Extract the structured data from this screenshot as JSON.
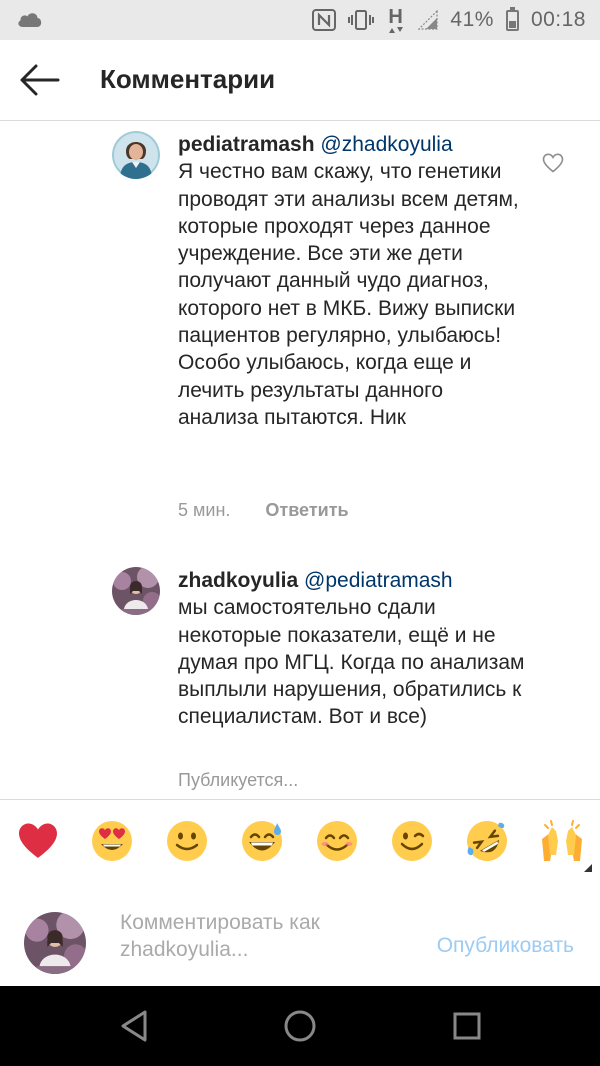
{
  "status_bar": {
    "battery_percent": "41%",
    "time": "00:18",
    "network": "H"
  },
  "header": {
    "title": "Комментарии"
  },
  "comments": [
    {
      "username": "pediatramash",
      "mention": "@zhadkoyulia",
      "text": "Я честно вам скажу, что генетики проводят эти анализы всем детям, которые проходят через данное учреждение. Все эти же дети получают данный чудо диагноз, которого нет в МКБ. Вижу выписки пациентов регулярно, улыбаюсь! Особо улыбаюсь, когда еще и лечить результаты данного анализа пытаются. Ник",
      "time": "5 мин.",
      "reply_label": "Ответить"
    },
    {
      "username": "zhadkoyulia",
      "mention": "@pediatramash",
      "text": "мы самостоятельно сдали некоторые показатели, ещё и не думая про МГЦ. Когда по анализам выплыли нарушения, обратились к специалистам. Вот и все)",
      "status": "Публикуется..."
    }
  ],
  "emoji_bar": [
    {
      "name": "red-heart"
    },
    {
      "name": "heart-eyes"
    },
    {
      "name": "slightly-smiling"
    },
    {
      "name": "grinning-sweat"
    },
    {
      "name": "smiling-eyes"
    },
    {
      "name": "winking"
    },
    {
      "name": "rolling-laughing"
    },
    {
      "name": "raised-hands"
    }
  ],
  "composer": {
    "placeholder_line1": "Комментировать как",
    "placeholder_line2": "zhadkoyulia...",
    "publish_label": "Опубликовать"
  },
  "colors": {
    "status_bar_bg": "#e9e9e9",
    "mention": "#003569",
    "muted": "#999999",
    "publish_disabled": "#9ccbf3",
    "nav_bar_bg": "#000000"
  }
}
